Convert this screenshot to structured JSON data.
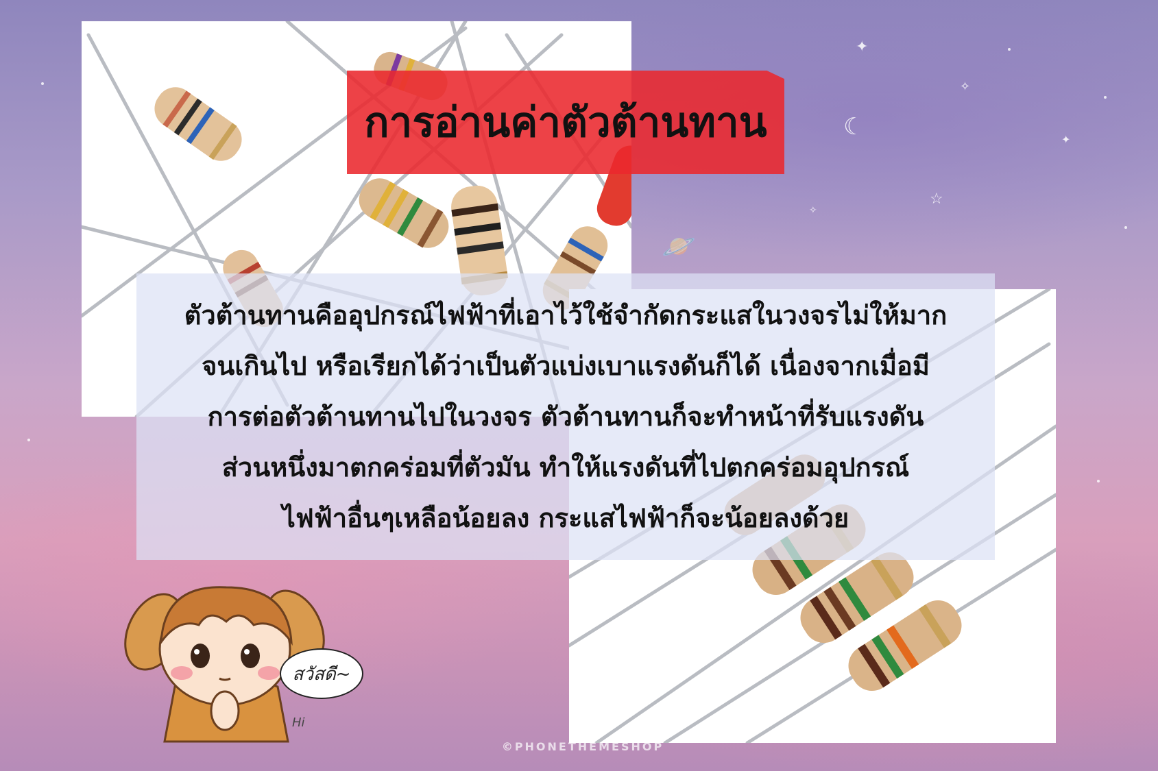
{
  "title": "การอ่านค่าตัวต้านทาน",
  "body_lines": [
    "ตัวต้านทานคืออุปกรณ์ไฟฟ้าที่เอาไว้ใช้จำกัดกระแสในวงจรไม่ให้มาก",
    "จนเกินไป หรือเรียกได้ว่าเป็นตัวแบ่งเบาแรงดันก็ได้ เนื่องจากเมื่อมี",
    "การต่อตัวต้านทานไปในวงจร ตัวต้านทานก็จะทำหน้าที่รับแรงดัน",
    "ส่วนหนึ่งมาตกคร่อมที่ตัวมัน ทำให้แรงดันที่ไปตกคร่อมอุปกรณ์",
    "ไฟฟ้าอื่นๆเหลือน้อยลง กระแสไฟฟ้าก็จะน้อยลงด้วย"
  ],
  "mascot": {
    "greeting": "สวัสดี~",
    "hi": "Hi"
  },
  "watermark": "©PHONETHEMESHOP",
  "colors": {
    "banner": "#eb282d",
    "panel": "#dce2f5",
    "sky_top": "#8f86bd",
    "sky_bottom": "#d99fbc"
  }
}
